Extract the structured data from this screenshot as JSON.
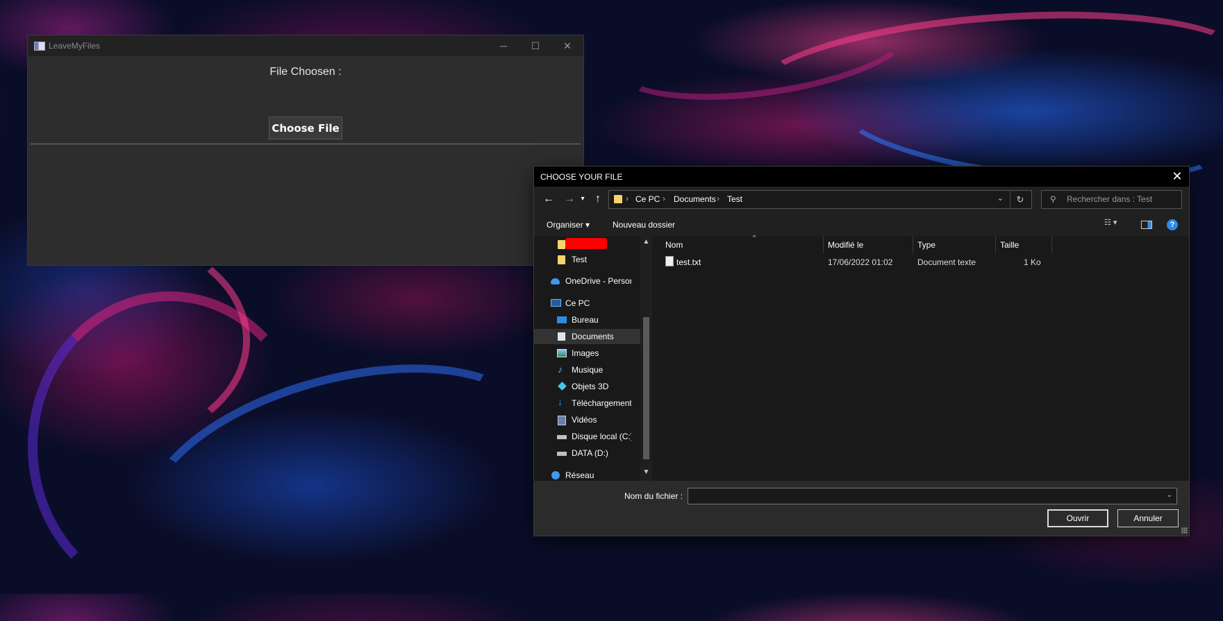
{
  "app_window": {
    "title": "LeaveMyFiles",
    "controls": {
      "minimize": "─",
      "maximize": "☐",
      "close": "✕"
    },
    "file_label": "File Choosen :",
    "choose_button": "Choose File"
  },
  "dialog": {
    "title": "CHOOSE YOUR FILE",
    "close": "✕",
    "nav": {
      "back": "←",
      "forward": "→",
      "recent": "▾",
      "up": "↑"
    },
    "breadcrumbs": [
      "Ce PC",
      "Documents",
      "Test"
    ],
    "address_dropdown": "⌄",
    "refresh": "↻",
    "search_placeholder": "Rechercher dans : Test",
    "toolbar": {
      "organiser": "Organiser ▾",
      "nouveau_dossier": "Nouveau dossier",
      "view": "☷ ▾",
      "help": "?"
    },
    "nav_pane": [
      {
        "label": "",
        "icon": "folder-icon",
        "redacted": true
      },
      {
        "label": "Test",
        "icon": "folder-icon"
      },
      {
        "label": "OneDrive - Person",
        "icon": "onedrive-icon"
      },
      {
        "label": "Ce PC",
        "icon": "computer-icon"
      },
      {
        "label": "Bureau",
        "icon": "desktop-icon"
      },
      {
        "label": "Documents",
        "icon": "documents-icon",
        "selected": true
      },
      {
        "label": "Images",
        "icon": "pictures-icon"
      },
      {
        "label": "Musique",
        "icon": "music-icon"
      },
      {
        "label": "Objets 3D",
        "icon": "3d-objects-icon"
      },
      {
        "label": "Téléchargements",
        "icon": "downloads-icon"
      },
      {
        "label": "Vidéos",
        "icon": "videos-icon"
      },
      {
        "label": "Disque local (C:)",
        "icon": "local-disk-icon"
      },
      {
        "label": "DATA (D:)",
        "icon": "drive-icon"
      },
      {
        "label": "Réseau",
        "icon": "network-icon"
      }
    ],
    "columns": [
      "Nom",
      "Modifié le",
      "Type",
      "Taille"
    ],
    "files": [
      {
        "name": "test.txt",
        "modified": "17/06/2022 01:02",
        "type": "Document texte",
        "size": "1 Ko"
      }
    ],
    "filename_label": "Nom du fichier :",
    "filename_value": "",
    "open_button": "Ouvrir",
    "cancel_button": "Annuler"
  }
}
